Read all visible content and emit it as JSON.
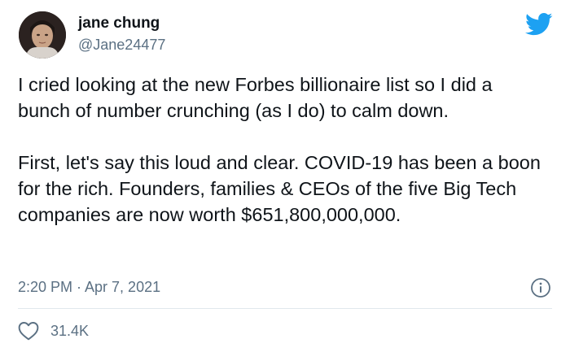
{
  "author": {
    "display_name": "jane chung",
    "handle": "@Jane24477"
  },
  "tweet": {
    "paragraphs": [
      "I cried looking at the new Forbes billionaire list so I did a bunch of number crunching (as I do) to calm down.",
      "First, let's say this loud and clear. COVID-19 has been a boon for the rich. Founders, families & CEOs of the five Big Tech companies are now worth $651,800,000,000."
    ],
    "timestamp": "2:20 PM · Apr 7, 2021",
    "likes": "31.4K"
  },
  "icons": {
    "brand": "twitter-bird-icon",
    "info": "info-icon",
    "like": "heart-icon"
  },
  "colors": {
    "brand_blue": "#1da1f2",
    "text": "#0f1419",
    "secondary_text": "#5b7083",
    "divider": "#e1e8ed"
  }
}
